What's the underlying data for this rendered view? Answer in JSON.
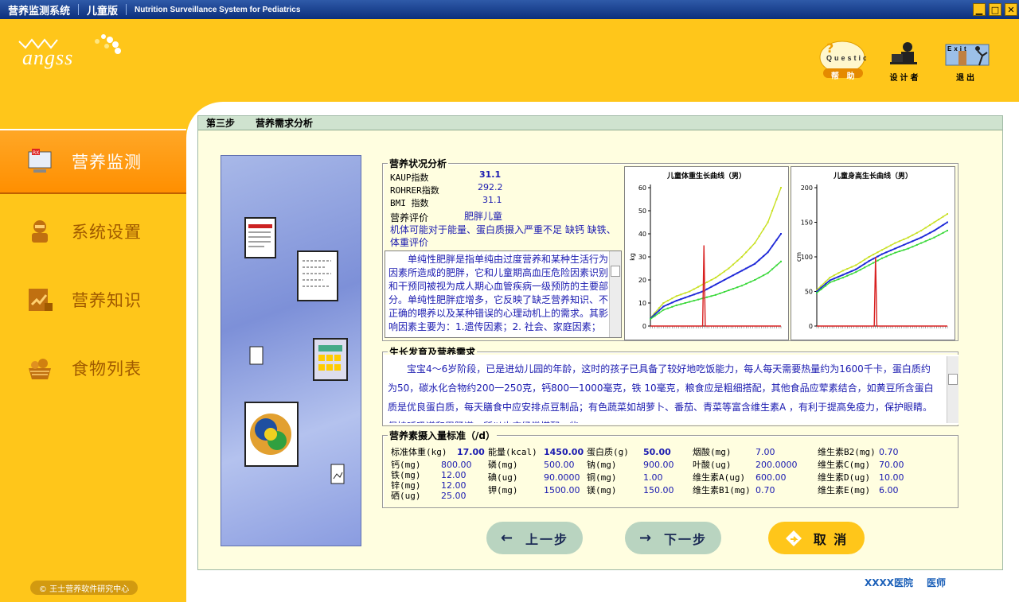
{
  "titlebar": {
    "app": "营养监测系统",
    "edition": "儿童版",
    "english": "Nutrition Surveillance System for Pediatrics",
    "buttons": [
      "minimize",
      "maximize",
      "close"
    ]
  },
  "logo": {
    "text": "angss"
  },
  "top_icons": [
    {
      "label": "帮 助",
      "icon": "help-questions-icon",
      "caption": "Questions?"
    },
    {
      "label": "设计者",
      "icon": "designer-icon"
    },
    {
      "label": "退出",
      "icon": "exit-icon",
      "caption": "Exit"
    }
  ],
  "sidebar": {
    "items": [
      {
        "label": "营养监测",
        "icon": "monitor-icon",
        "active": true
      },
      {
        "label": "系统设置",
        "icon": "settings-icon"
      },
      {
        "label": "营养知识",
        "icon": "knowledge-icon"
      },
      {
        "label": "食物列表",
        "icon": "food-basket-icon"
      }
    ],
    "company": "© 王士营养软件研究中心"
  },
  "step": {
    "number": "第三步",
    "title": "营养需求分析"
  },
  "status": {
    "title": "营养状况分析",
    "kaup_label": "KAUP指数",
    "kaup": "31.1",
    "rohrer_label": "ROHRER指数",
    "rohrer": "292.2",
    "bmi_label": "BMI 指数",
    "bmi": "31.1",
    "eval_label": "营养评价",
    "eval": "肥胖儿童",
    "note": "机体可能对于能量、蛋白质摄入严重不足 缺钙 缺铁、体重评价",
    "description": "单纯性肥胖是指单纯由过度营养和某种生活行为因素所造成的肥胖，它和儿童期高血压危险因素识别和干预同被视为成人期心血管疾病一级预防的主要部分。单纯性肥胖症增多，它反映了缺乏营养知识、不正确的喂养以及某种错误的心理动机上的需求。其影响因素主要为：1.遗传因素；2. 社会、家庭因素；"
  },
  "charts": {
    "weight": {
      "title": "儿童体重生长曲线（男）",
      "ylabel": "kg"
    },
    "height": {
      "title": "儿童身高生长曲线（男）",
      "ylabel": "cm"
    }
  },
  "chart_data": [
    {
      "type": "line",
      "title": "儿童体重生长曲线（男）",
      "ylabel": "kg",
      "ylim": [
        0,
        60
      ],
      "yticks": [
        0,
        10,
        20,
        30,
        40,
        50,
        60
      ],
      "x": [
        0,
        10,
        20,
        30,
        40,
        50,
        60,
        70,
        80,
        90,
        100
      ],
      "series": [
        {
          "color": "#c8e020",
          "values": [
            3.5,
            10,
            13,
            15,
            18,
            21,
            25,
            30,
            36,
            45,
            60
          ]
        },
        {
          "color": "#1e28d8",
          "values": [
            3.3,
            8.5,
            11,
            13,
            15,
            18,
            21,
            24,
            27,
            32,
            40
          ]
        },
        {
          "color": "#38d838",
          "values": [
            3,
            7,
            9,
            10.5,
            12,
            13.5,
            15.5,
            17.5,
            20,
            23,
            28
          ]
        },
        {
          "color": "#d82020",
          "values": [
            0,
            0,
            0,
            0,
            0,
            0,
            0,
            0,
            0,
            0,
            0
          ],
          "spike": {
            "x": 41,
            "y": 35
          }
        }
      ]
    },
    {
      "type": "line",
      "title": "儿童身高生长曲线（男）",
      "ylabel": "cm",
      "ylim": [
        0,
        200
      ],
      "yticks": [
        0,
        50,
        100,
        150,
        200
      ],
      "x": [
        0,
        10,
        20,
        30,
        40,
        50,
        60,
        70,
        80,
        90,
        100
      ],
      "series": [
        {
          "color": "#c8e020",
          "values": [
            52,
            70,
            80,
            88,
            100,
            110,
            120,
            128,
            138,
            150,
            162
          ]
        },
        {
          "color": "#1e28d8",
          "values": [
            50,
            66,
            74,
            82,
            94,
            104,
            112,
            120,
            128,
            138,
            150
          ]
        },
        {
          "color": "#38d838",
          "values": [
            48,
            63,
            70,
            78,
            88,
            98,
            106,
            112,
            120,
            128,
            138
          ]
        },
        {
          "color": "#d82020",
          "values": [
            0,
            0,
            0,
            0,
            0,
            0,
            0,
            0,
            0,
            0,
            0
          ],
          "spike": {
            "x": 45,
            "y": 100
          }
        }
      ]
    }
  ],
  "growth": {
    "title": "生长发育及营养需求",
    "text": "宝宝4～6岁阶段，已是进幼儿园的年龄，这时的孩子已具备了较好地吃饭能力，每人每天需要热量约为1600千卡，蛋白质约为50，碳水化合物约200一250克，钙800一1000毫克，铁 10毫克，粮食应是粗细搭配，其他食品应荤素结合，如黄豆所含蛋白质是优良蛋白质，每天膳食中应安排点豆制品；有色蔬菜如胡萝卜、番茄、青菜等富含维生素A ，有利于提高免疫力，保护眼睛。保持呼吸道和胃肠道，所以也应经常搭配一些"
  },
  "intake": {
    "title": "营养素摄入量标准（/d）",
    "col1": [
      {
        "label": "标准体重(kg)",
        "value": "17.00",
        "bold": true
      },
      {
        "label": "钙(mg)",
        "value": "800.00"
      },
      {
        "label": "铁(mg)",
        "value": "12.00"
      },
      {
        "label": "锌(mg)",
        "value": "12.00"
      },
      {
        "label": "硒(ug)",
        "value": "25.00"
      }
    ],
    "col2": [
      {
        "label": "能量(kcal)",
        "value": "1450.00",
        "bold": true
      },
      {
        "label": "磷(mg)",
        "value": "500.00"
      },
      {
        "label": "碘(ug)",
        "value": "90.0000"
      },
      {
        "label": "钾(mg)",
        "value": "1500.00"
      }
    ],
    "col3": [
      {
        "label": "蛋白质(g)",
        "value": "50.00",
        "bold": true
      },
      {
        "label": "钠(mg)",
        "value": "900.00"
      },
      {
        "label": "铜(mg)",
        "value": "1.00"
      },
      {
        "label": "镁(mg)",
        "value": "150.00"
      }
    ],
    "col4": [
      {
        "label": "烟酸(mg)",
        "value": "7.00"
      },
      {
        "label": "叶酸(ug)",
        "value": "200.0000"
      },
      {
        "label": "维生素A(ug)",
        "value": "600.00"
      },
      {
        "label": "维生素B1(mg)",
        "value": "0.70"
      }
    ],
    "col5": [
      {
        "label": "维生素B2(mg)",
        "value": "0.70"
      },
      {
        "label": "维生素C(mg)",
        "value": "70.00"
      },
      {
        "label": "维生素D(ug)",
        "value": "10.00"
      },
      {
        "label": "维生素E(mg)",
        "value": "6.00"
      }
    ]
  },
  "buttons": {
    "prev": "上一步",
    "next": "下一步",
    "cancel": "取 消"
  },
  "footer": {
    "hospital": "XXXX医院",
    "doctor": "医师"
  }
}
